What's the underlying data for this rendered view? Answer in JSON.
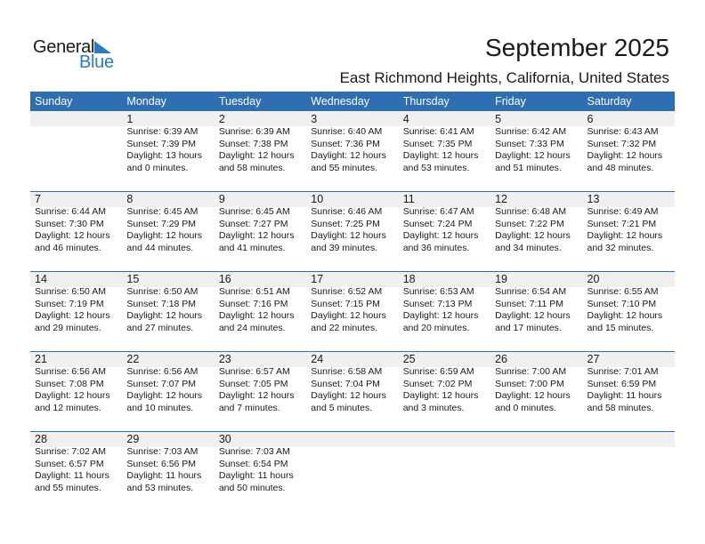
{
  "logo": {
    "general": "General",
    "blue": "Blue"
  },
  "title": "September 2025",
  "location": "East Richmond Heights, California, United States",
  "weekdays": [
    "Sunday",
    "Monday",
    "Tuesday",
    "Wednesday",
    "Thursday",
    "Friday",
    "Saturday"
  ],
  "weeks": [
    [
      null,
      {
        "day": "1",
        "sunrise": "Sunrise: 6:39 AM",
        "sunset": "Sunset: 7:39 PM",
        "daylight1": "Daylight: 13 hours",
        "daylight2": "and 0 minutes."
      },
      {
        "day": "2",
        "sunrise": "Sunrise: 6:39 AM",
        "sunset": "Sunset: 7:38 PM",
        "daylight1": "Daylight: 12 hours",
        "daylight2": "and 58 minutes."
      },
      {
        "day": "3",
        "sunrise": "Sunrise: 6:40 AM",
        "sunset": "Sunset: 7:36 PM",
        "daylight1": "Daylight: 12 hours",
        "daylight2": "and 55 minutes."
      },
      {
        "day": "4",
        "sunrise": "Sunrise: 6:41 AM",
        "sunset": "Sunset: 7:35 PM",
        "daylight1": "Daylight: 12 hours",
        "daylight2": "and 53 minutes."
      },
      {
        "day": "5",
        "sunrise": "Sunrise: 6:42 AM",
        "sunset": "Sunset: 7:33 PM",
        "daylight1": "Daylight: 12 hours",
        "daylight2": "and 51 minutes."
      },
      {
        "day": "6",
        "sunrise": "Sunrise: 6:43 AM",
        "sunset": "Sunset: 7:32 PM",
        "daylight1": "Daylight: 12 hours",
        "daylight2": "and 48 minutes."
      }
    ],
    [
      {
        "day": "7",
        "sunrise": "Sunrise: 6:44 AM",
        "sunset": "Sunset: 7:30 PM",
        "daylight1": "Daylight: 12 hours",
        "daylight2": "and 46 minutes."
      },
      {
        "day": "8",
        "sunrise": "Sunrise: 6:45 AM",
        "sunset": "Sunset: 7:29 PM",
        "daylight1": "Daylight: 12 hours",
        "daylight2": "and 44 minutes."
      },
      {
        "day": "9",
        "sunrise": "Sunrise: 6:45 AM",
        "sunset": "Sunset: 7:27 PM",
        "daylight1": "Daylight: 12 hours",
        "daylight2": "and 41 minutes."
      },
      {
        "day": "10",
        "sunrise": "Sunrise: 6:46 AM",
        "sunset": "Sunset: 7:25 PM",
        "daylight1": "Daylight: 12 hours",
        "daylight2": "and 39 minutes."
      },
      {
        "day": "11",
        "sunrise": "Sunrise: 6:47 AM",
        "sunset": "Sunset: 7:24 PM",
        "daylight1": "Daylight: 12 hours",
        "daylight2": "and 36 minutes."
      },
      {
        "day": "12",
        "sunrise": "Sunrise: 6:48 AM",
        "sunset": "Sunset: 7:22 PM",
        "daylight1": "Daylight: 12 hours",
        "daylight2": "and 34 minutes."
      },
      {
        "day": "13",
        "sunrise": "Sunrise: 6:49 AM",
        "sunset": "Sunset: 7:21 PM",
        "daylight1": "Daylight: 12 hours",
        "daylight2": "and 32 minutes."
      }
    ],
    [
      {
        "day": "14",
        "sunrise": "Sunrise: 6:50 AM",
        "sunset": "Sunset: 7:19 PM",
        "daylight1": "Daylight: 12 hours",
        "daylight2": "and 29 minutes."
      },
      {
        "day": "15",
        "sunrise": "Sunrise: 6:50 AM",
        "sunset": "Sunset: 7:18 PM",
        "daylight1": "Daylight: 12 hours",
        "daylight2": "and 27 minutes."
      },
      {
        "day": "16",
        "sunrise": "Sunrise: 6:51 AM",
        "sunset": "Sunset: 7:16 PM",
        "daylight1": "Daylight: 12 hours",
        "daylight2": "and 24 minutes."
      },
      {
        "day": "17",
        "sunrise": "Sunrise: 6:52 AM",
        "sunset": "Sunset: 7:15 PM",
        "daylight1": "Daylight: 12 hours",
        "daylight2": "and 22 minutes."
      },
      {
        "day": "18",
        "sunrise": "Sunrise: 6:53 AM",
        "sunset": "Sunset: 7:13 PM",
        "daylight1": "Daylight: 12 hours",
        "daylight2": "and 20 minutes."
      },
      {
        "day": "19",
        "sunrise": "Sunrise: 6:54 AM",
        "sunset": "Sunset: 7:11 PM",
        "daylight1": "Daylight: 12 hours",
        "daylight2": "and 17 minutes."
      },
      {
        "day": "20",
        "sunrise": "Sunrise: 6:55 AM",
        "sunset": "Sunset: 7:10 PM",
        "daylight1": "Daylight: 12 hours",
        "daylight2": "and 15 minutes."
      }
    ],
    [
      {
        "day": "21",
        "sunrise": "Sunrise: 6:56 AM",
        "sunset": "Sunset: 7:08 PM",
        "daylight1": "Daylight: 12 hours",
        "daylight2": "and 12 minutes."
      },
      {
        "day": "22",
        "sunrise": "Sunrise: 6:56 AM",
        "sunset": "Sunset: 7:07 PM",
        "daylight1": "Daylight: 12 hours",
        "daylight2": "and 10 minutes."
      },
      {
        "day": "23",
        "sunrise": "Sunrise: 6:57 AM",
        "sunset": "Sunset: 7:05 PM",
        "daylight1": "Daylight: 12 hours",
        "daylight2": "and 7 minutes."
      },
      {
        "day": "24",
        "sunrise": "Sunrise: 6:58 AM",
        "sunset": "Sunset: 7:04 PM",
        "daylight1": "Daylight: 12 hours",
        "daylight2": "and 5 minutes."
      },
      {
        "day": "25",
        "sunrise": "Sunrise: 6:59 AM",
        "sunset": "Sunset: 7:02 PM",
        "daylight1": "Daylight: 12 hours",
        "daylight2": "and 3 minutes."
      },
      {
        "day": "26",
        "sunrise": "Sunrise: 7:00 AM",
        "sunset": "Sunset: 7:00 PM",
        "daylight1": "Daylight: 12 hours",
        "daylight2": "and 0 minutes."
      },
      {
        "day": "27",
        "sunrise": "Sunrise: 7:01 AM",
        "sunset": "Sunset: 6:59 PM",
        "daylight1": "Daylight: 11 hours",
        "daylight2": "and 58 minutes."
      }
    ],
    [
      {
        "day": "28",
        "sunrise": "Sunrise: 7:02 AM",
        "sunset": "Sunset: 6:57 PM",
        "daylight1": "Daylight: 11 hours",
        "daylight2": "and 55 minutes."
      },
      {
        "day": "29",
        "sunrise": "Sunrise: 7:03 AM",
        "sunset": "Sunset: 6:56 PM",
        "daylight1": "Daylight: 11 hours",
        "daylight2": "and 53 minutes."
      },
      {
        "day": "30",
        "sunrise": "Sunrise: 7:03 AM",
        "sunset": "Sunset: 6:54 PM",
        "daylight1": "Daylight: 11 hours",
        "daylight2": "and 50 minutes."
      },
      null,
      null,
      null,
      null
    ]
  ]
}
